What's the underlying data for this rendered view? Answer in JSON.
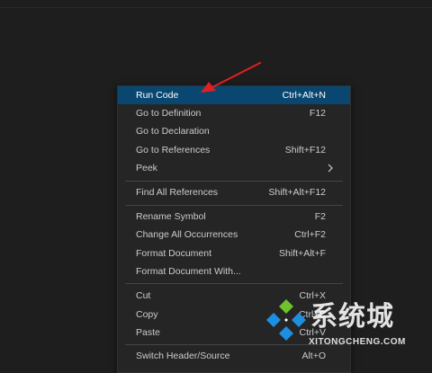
{
  "context_menu": {
    "items": [
      {
        "label": "Run Code",
        "shortcut": "Ctrl+Alt+N",
        "highlighted": true
      },
      {
        "label": "Go to Definition",
        "shortcut": "F12"
      },
      {
        "label": "Go to Declaration",
        "shortcut": ""
      },
      {
        "label": "Go to References",
        "shortcut": "Shift+F12"
      },
      {
        "label": "Peek",
        "shortcut": "",
        "submenu": true
      },
      {
        "label": "Find All References",
        "shortcut": "Shift+Alt+F12"
      },
      {
        "label": "Rename Symbol",
        "shortcut": "F2"
      },
      {
        "label": "Change All Occurrences",
        "shortcut": "Ctrl+F2"
      },
      {
        "label": "Format Document",
        "shortcut": "Shift+Alt+F"
      },
      {
        "label": "Format Document With...",
        "shortcut": ""
      },
      {
        "label": "Cut",
        "shortcut": "Ctrl+X"
      },
      {
        "label": "Copy",
        "shortcut": "Ctrl+C"
      },
      {
        "label": "Paste",
        "shortcut": "Ctrl+V"
      },
      {
        "label": "Switch Header/Source",
        "shortcut": "Alt+O"
      }
    ]
  },
  "colors": {
    "background": "#1e1e1e",
    "menu_background": "#252526",
    "highlight": "#094771",
    "menu_text": "#cccccc",
    "annotation_arrow": "#e02020"
  },
  "watermark": {
    "chinese": "系统城",
    "domain": "XITONGCHENG.COM"
  }
}
